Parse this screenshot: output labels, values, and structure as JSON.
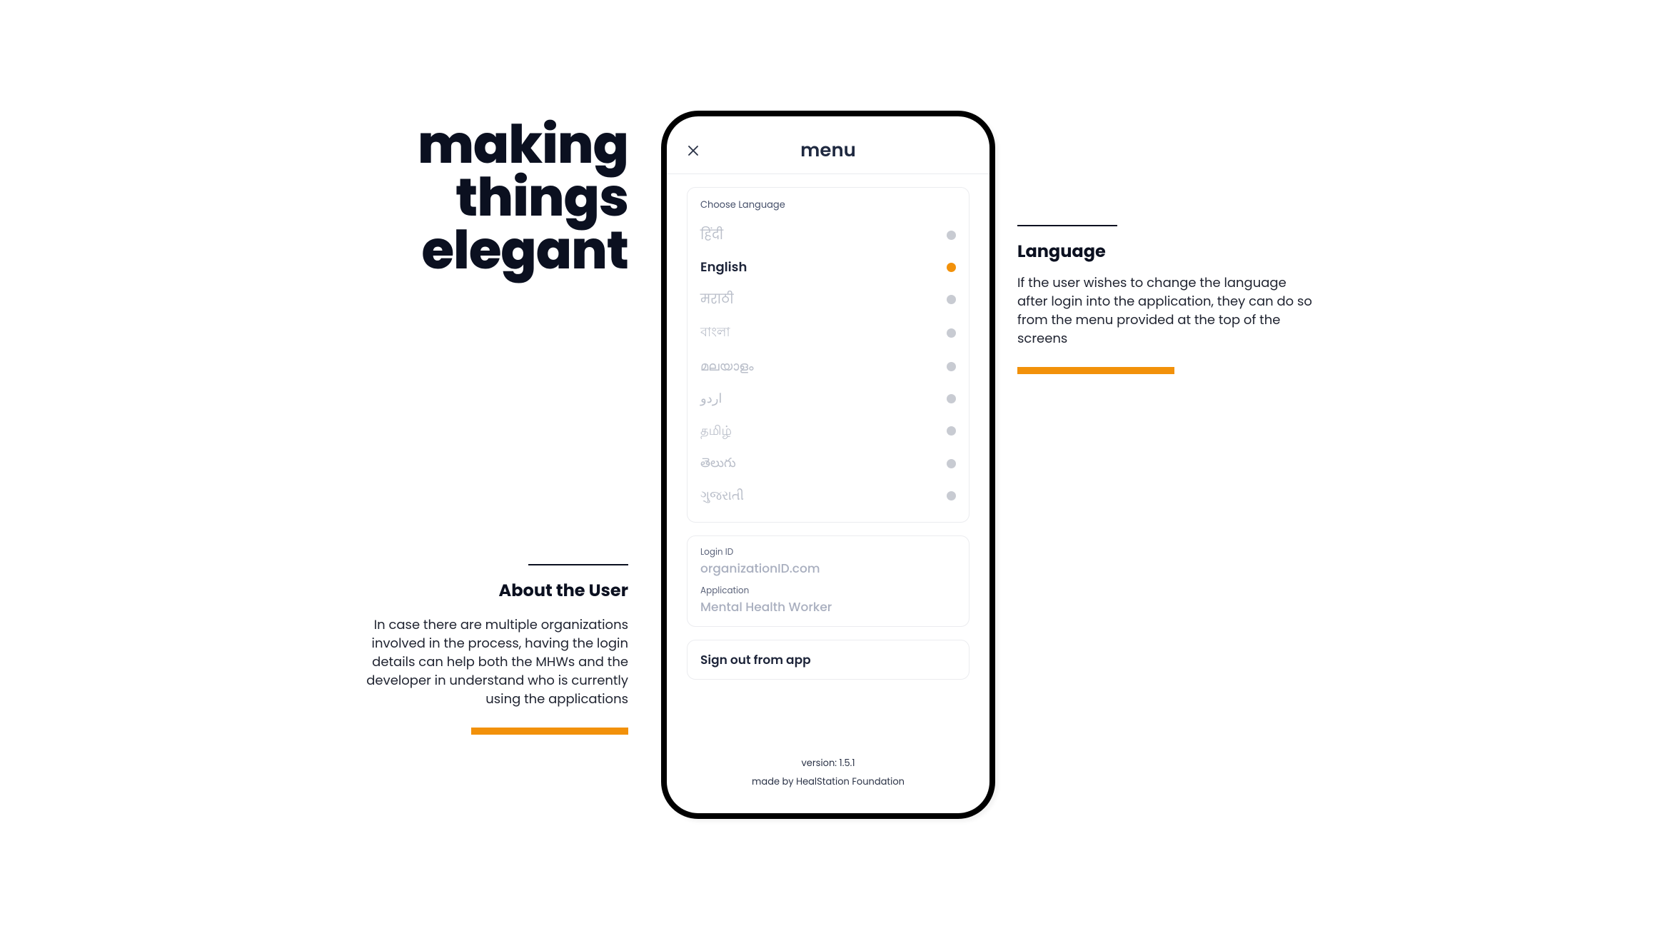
{
  "headline": {
    "line1": "making",
    "line2": "things",
    "line3": "elegant"
  },
  "about": {
    "title": "About the User",
    "body": "In case there are multiple organizations involved in the process, having the login details can help both the MHWs and the developer in understand who is currently using the applications"
  },
  "language_note": {
    "title": "Language",
    "body": "If the user wishes to change the language after login into the application, they can do so from the menu provided at the top of the screens"
  },
  "menu": {
    "title": "menu",
    "choose_label": "Choose Language",
    "languages": [
      {
        "label": "हिंदी",
        "selected": false
      },
      {
        "label": "English",
        "selected": true
      },
      {
        "label": "मराठी",
        "selected": false
      },
      {
        "label": "বাংলা",
        "selected": false
      },
      {
        "label": "മലയാളം",
        "selected": false
      },
      {
        "label": "اردو",
        "selected": false
      },
      {
        "label": "தமிழ்",
        "selected": false
      },
      {
        "label": "తెలుగు",
        "selected": false
      },
      {
        "label": "ગુજરાતી",
        "selected": false
      }
    ],
    "login_id_label": "Login ID",
    "login_id_value": "organizationID.com",
    "application_label": "Application",
    "application_value": "Mental Health Worker",
    "signout": "Sign out from app",
    "version": "version: 1.5.1",
    "made_by": "made by HealStation Foundation"
  },
  "colors": {
    "accent": "#f2910a"
  }
}
